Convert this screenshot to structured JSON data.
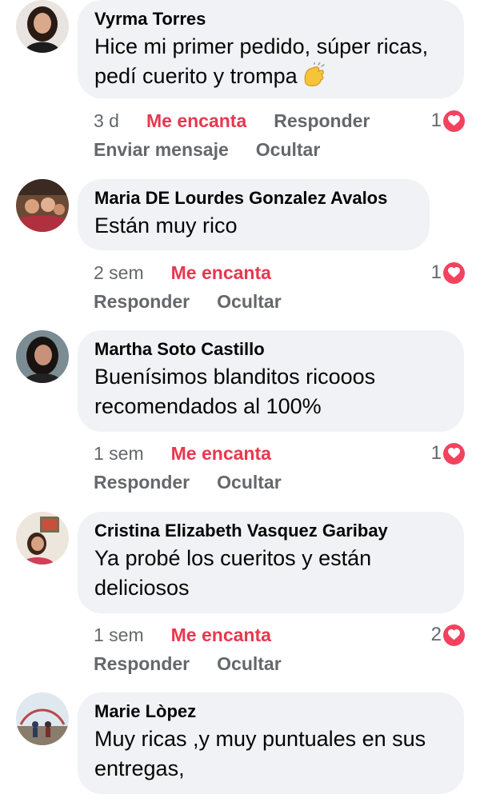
{
  "labels": {
    "me_encanta": "Me encanta",
    "responder": "Responder",
    "ocultar": "Ocultar",
    "enviar_mensaje": "Enviar mensaje"
  },
  "comments": [
    {
      "author": "Vyrma Torres",
      "text": "Hice mi primer pedido, súper ricas, pedí cuerito y trompa",
      "emoji": "clapping-hands-icon",
      "time": "3 d",
      "reaction_count": "1",
      "reaction": "heart-icon"
    },
    {
      "author": "Maria DE Lourdes Gonzalez Avalos",
      "text": "Están muy rico",
      "time": "2 sem",
      "reaction_count": "1",
      "reaction": "heart-icon"
    },
    {
      "author": "Martha Soto Castillo",
      "text": "Buenísimos blanditos ricooos recomendados al 100%",
      "time": "1 sem",
      "reaction_count": "1",
      "reaction": "heart-icon"
    },
    {
      "author": "Cristina Elizabeth Vasquez Garibay",
      "text": "Ya probé los cueritos y están deliciosos",
      "time": "1 sem",
      "reaction_count": "2",
      "reaction": "heart-icon"
    },
    {
      "author": "Marie Lòpez",
      "text": "Muy ricas ,y muy puntuales en sus entregas,"
    }
  ],
  "colors": {
    "bubble": "#f0f2f5",
    "love_text": "#e8374f",
    "heart_badge": "#f3425f",
    "meta_text": "#65676b"
  }
}
